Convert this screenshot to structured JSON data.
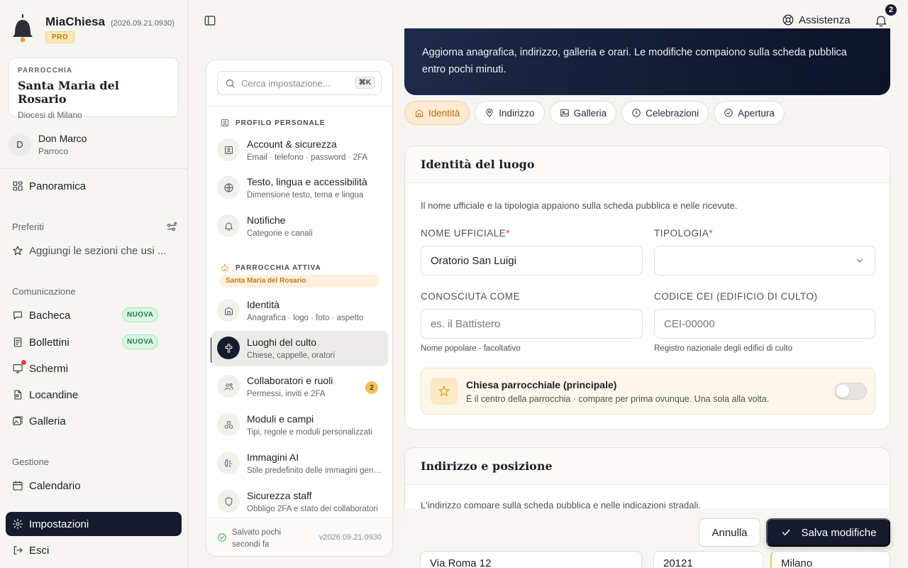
{
  "brand": {
    "name": "MiaChiesa",
    "version": "(2026.09.21.0930)",
    "plan": "PRO"
  },
  "parish": {
    "kicker": "PARROCCHIA",
    "name": "Santa Maria del Rosario",
    "diocese": "Diocesi di Milano"
  },
  "user": {
    "initial": "D",
    "name": "Don Marco",
    "role": "Parroco"
  },
  "nav": {
    "overview": "Panoramica",
    "favorites_title": "Preferiti",
    "favorites_placeholder": "Aggiungi le sezioni che usi ...",
    "communication_title": "Comunicazione",
    "board": "Bacheca",
    "board_badge": "NUOVA",
    "bulletins": "Bollettini",
    "bulletins_badge": "NUOVA",
    "screens": "Schermi",
    "posters": "Locandine",
    "gallery": "Galleria",
    "management_title": "Gestione",
    "calendar": "Calendario",
    "settings": "Impostazioni",
    "logout": "Esci"
  },
  "topbar": {
    "assist": "Assistenza",
    "notifications_count": "2"
  },
  "settings_panel": {
    "search_placeholder": "Cerca impostazione...",
    "search_shortcut": "⌘K",
    "personal_title": "PROFILO PERSONALE",
    "parish_title": "PARROCCHIA ATTIVA",
    "parish_tag": "Santa Maria del Rosario",
    "items": [
      {
        "title": "Account & sicurezza",
        "desc": "Email · telefono · password · 2FA"
      },
      {
        "title": "Testo, lingua e accessibilità",
        "desc": "Dimensione testo, tema e lingua"
      },
      {
        "title": "Notifiche",
        "desc": "Categorie e canali"
      },
      {
        "title": "Identità",
        "desc": "Anagrafica · logo · foto · aspetto"
      },
      {
        "title": "Luoghi del culto",
        "desc": "Chiese, cappelle, oratori"
      },
      {
        "title": "Collaboratori e ruoli",
        "desc": "Permessi, inviti e 2FA",
        "badge": "2"
      },
      {
        "title": "Moduli e campi",
        "desc": "Tipi, regole e moduli personalizzati"
      },
      {
        "title": "Immagini AI",
        "desc": "Stile predefinito delle immagini generate"
      },
      {
        "title": "Sicurezza staff",
        "desc": "Obbligo 2FA e stato dei collaboratori"
      }
    ],
    "saved": "Salvato pochi secondi fa",
    "version": "v2026.09.21.0930"
  },
  "hero": {
    "description": "Aggiorna anagrafica, indirizzo, galleria e orari. Le modifiche compaiono sulla scheda pubblica entro pochi minuti."
  },
  "tabs": [
    "Identità",
    "Indirizzo",
    "Galleria",
    "Celebrazioni",
    "Apertura"
  ],
  "identity_card": {
    "title": "Identità del luogo",
    "intro": "Il nome ufficiale e la tipologia appaiono sulla scheda pubblica e nelle ricevute.",
    "official_name_label": "NOME UFFICIALE",
    "official_name_value": "Oratorio San Luigi",
    "type_label": "TIPOLOGIA",
    "type_value": "",
    "known_as_label": "CONOSCIUTA COME",
    "known_as_placeholder": "es. il Battistero",
    "known_as_helper": "Nome popolare · facoltativo",
    "cei_label": "CODICE CEI (EDIFICIO DI CULTO)",
    "cei_placeholder": "CEI-00000",
    "cei_helper": "Registro nazionale degli edifici di culto",
    "main_church_title": "Chiesa parrocchiale (principale)",
    "main_church_desc": "È il centro della parrocchia · compare per prima ovunque. Una sola alla volta.",
    "main_church_on": false
  },
  "address_card": {
    "title": "Indirizzo e posizione",
    "intro": "L'indirizzo compare sulla scheda pubblica e nelle indicazioni stradali.",
    "street": "Via Roma 12",
    "zip": "20121",
    "city": "Milano"
  },
  "actions": {
    "cancel": "Annulla",
    "save": "Salva modifiche"
  },
  "colors": {
    "accent_dark": "#151b2c",
    "amber": "#d79a2b",
    "success": "#2f9e55",
    "danger": "#e23b3b"
  }
}
